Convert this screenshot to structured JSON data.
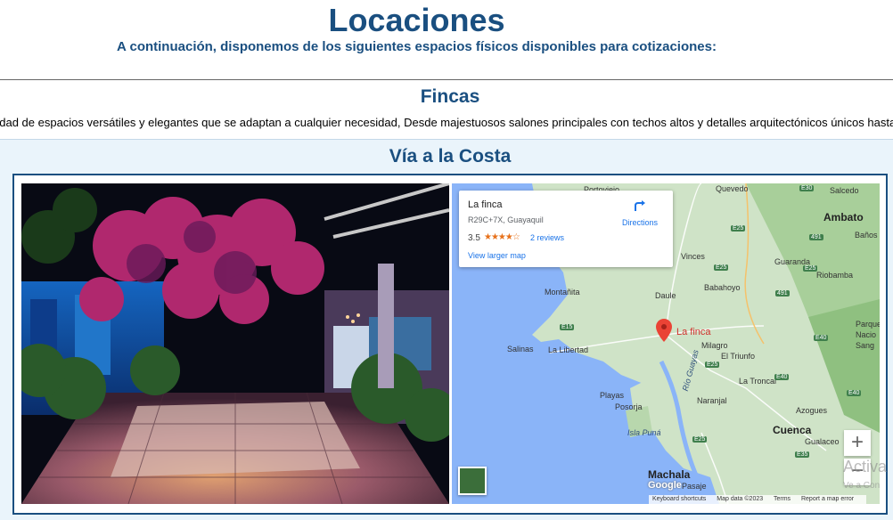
{
  "header": {
    "title": "Locaciones",
    "subtitle": "A continuación, disponemos de los siguientes espacios físicos disponibles para cotizaciones:"
  },
  "section": {
    "title": "Fincas",
    "description": "edad de espacios versátiles y elegantes que se adaptan a cualquier necesidad, Desde majestuosos salones principales con techos altos y detalles arquitectónicos únicos hasta e"
  },
  "location": {
    "title": "Vía a la Costa"
  },
  "map": {
    "place_name": "La finca",
    "address": "R29C+7X, Guayaquil",
    "rating": "3.5",
    "stars": "★★★★☆",
    "reviews": "2 reviews",
    "view_larger": "View larger map",
    "directions": "Directions",
    "pin_label": "La finca",
    "zoom_in": "+",
    "zoom_out": "−",
    "google": "Google",
    "attribution": {
      "shortcuts": "Keyboard shortcuts",
      "data": "Map data ©2023",
      "terms": "Terms",
      "report": "Report a map error"
    },
    "places": {
      "quevedo": "Quevedo",
      "salcedo": "Salcedo",
      "ambato": "Ambato",
      "banos": "Baños",
      "portoviejo": "Portoviejo",
      "vinces": "Vinces",
      "guaranda": "Guaranda",
      "riobamba": "Riobamba",
      "montanita": "Montañita",
      "daule": "Daule",
      "babahoyo": "Babahoyo",
      "milagro": "Milagro",
      "salinas": "Salinas",
      "la_libertad": "La Libertad",
      "el_triunfo": "El Triunfo",
      "la_troncal": "La Troncal",
      "playas": "Playas",
      "posorja": "Posorja",
      "naranjal": "Naranjal",
      "azogues": "Azogues",
      "isla_puna": "Isla Puná",
      "cuenca": "Cuenca",
      "gualaceo": "Gualaceo",
      "machala": "Machala",
      "pasaje": "Pasaje",
      "rio_guayas": "Río Guayas",
      "parque_1": "Parque",
      "parque_2": "Nacio",
      "parque_3": "Sang"
    },
    "highways": [
      "E30",
      "E25",
      "491",
      "E25",
      "E25",
      "491",
      "E15",
      "E25",
      "E40",
      "E40",
      "E40",
      "E25",
      "E35"
    ]
  },
  "watermark": {
    "title": "Activa",
    "subtitle": "Ve a Con"
  },
  "colors": {
    "heading": "#1a4f80",
    "band": "#eaf4fb",
    "link": "#1a73e8",
    "pin": "#ea4335"
  }
}
